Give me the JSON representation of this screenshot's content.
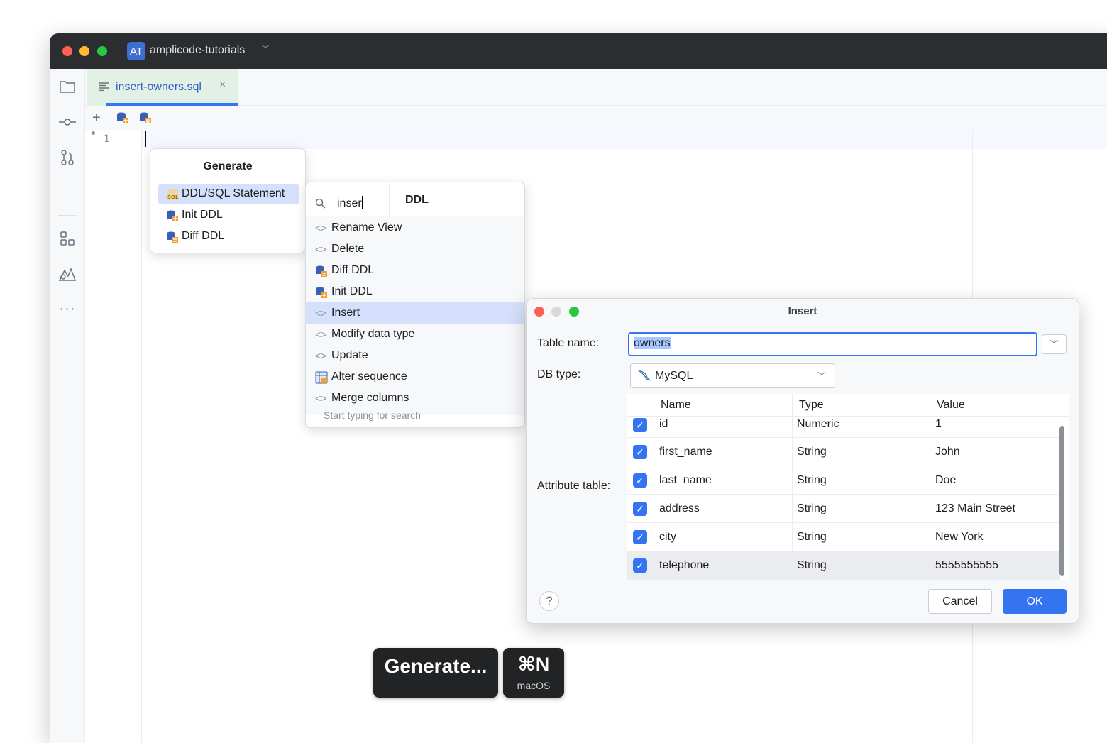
{
  "window": {
    "project_badge": "AT",
    "project_name": "amplicode-tutorials"
  },
  "tab": {
    "label": "insert-owners.sql"
  },
  "editor": {
    "line_number": "1"
  },
  "generate_popup": {
    "title": "Generate",
    "items": [
      {
        "label": "DDL/SQL Statement",
        "selected": true
      },
      {
        "label": "Init DDL"
      },
      {
        "label": "Diff DDL"
      }
    ]
  },
  "ddl_popup": {
    "search_value": "inser",
    "heading": "DDL",
    "items": [
      {
        "label": "Rename View",
        "icon": "code-brackets-icon"
      },
      {
        "label": "Delete",
        "icon": "code-brackets-icon"
      },
      {
        "label": "Diff DDL",
        "icon": "db-diff-icon"
      },
      {
        "label": "Init DDL",
        "icon": "db-init-icon"
      },
      {
        "label": "Insert",
        "icon": "code-brackets-icon",
        "selected": true
      },
      {
        "label": "Modify data type",
        "icon": "code-brackets-icon"
      },
      {
        "label": "Update",
        "icon": "code-brackets-icon"
      },
      {
        "label": "Alter sequence",
        "icon": "sequence-icon"
      },
      {
        "label": "Merge columns",
        "icon": "code-brackets-icon"
      }
    ],
    "hint": "Start typing for search"
  },
  "insert_dialog": {
    "title": "Insert",
    "table_name_label": "Table name:",
    "table_name_value": "owners",
    "db_type_label": "DB type:",
    "db_type_value": "MySQL",
    "attr_table_label": "Attribute table:",
    "columns": [
      "Name",
      "Type",
      "Value"
    ],
    "rows": [
      {
        "name": "id",
        "type": "Numeric",
        "value": "1",
        "checked": true
      },
      {
        "name": "first_name",
        "type": "String",
        "value": "John",
        "checked": true
      },
      {
        "name": "last_name",
        "type": "String",
        "value": "Doe",
        "checked": true
      },
      {
        "name": "address",
        "type": "String",
        "value": "123 Main Street",
        "checked": true
      },
      {
        "name": "city",
        "type": "String",
        "value": "New York",
        "checked": true
      },
      {
        "name": "telephone",
        "type": "String",
        "value": "5555555555",
        "checked": true
      }
    ],
    "help_label": "?",
    "cancel_label": "Cancel",
    "ok_label": "OK"
  },
  "keystroke": {
    "action": "Generate...",
    "shortcut": "⌘N",
    "os": "macOS"
  },
  "colors": {
    "accent": "#3574f0",
    "titlebar": "#2b2d30",
    "selection": "#d5e1fc",
    "tab_bg": "#e3f0e6"
  }
}
